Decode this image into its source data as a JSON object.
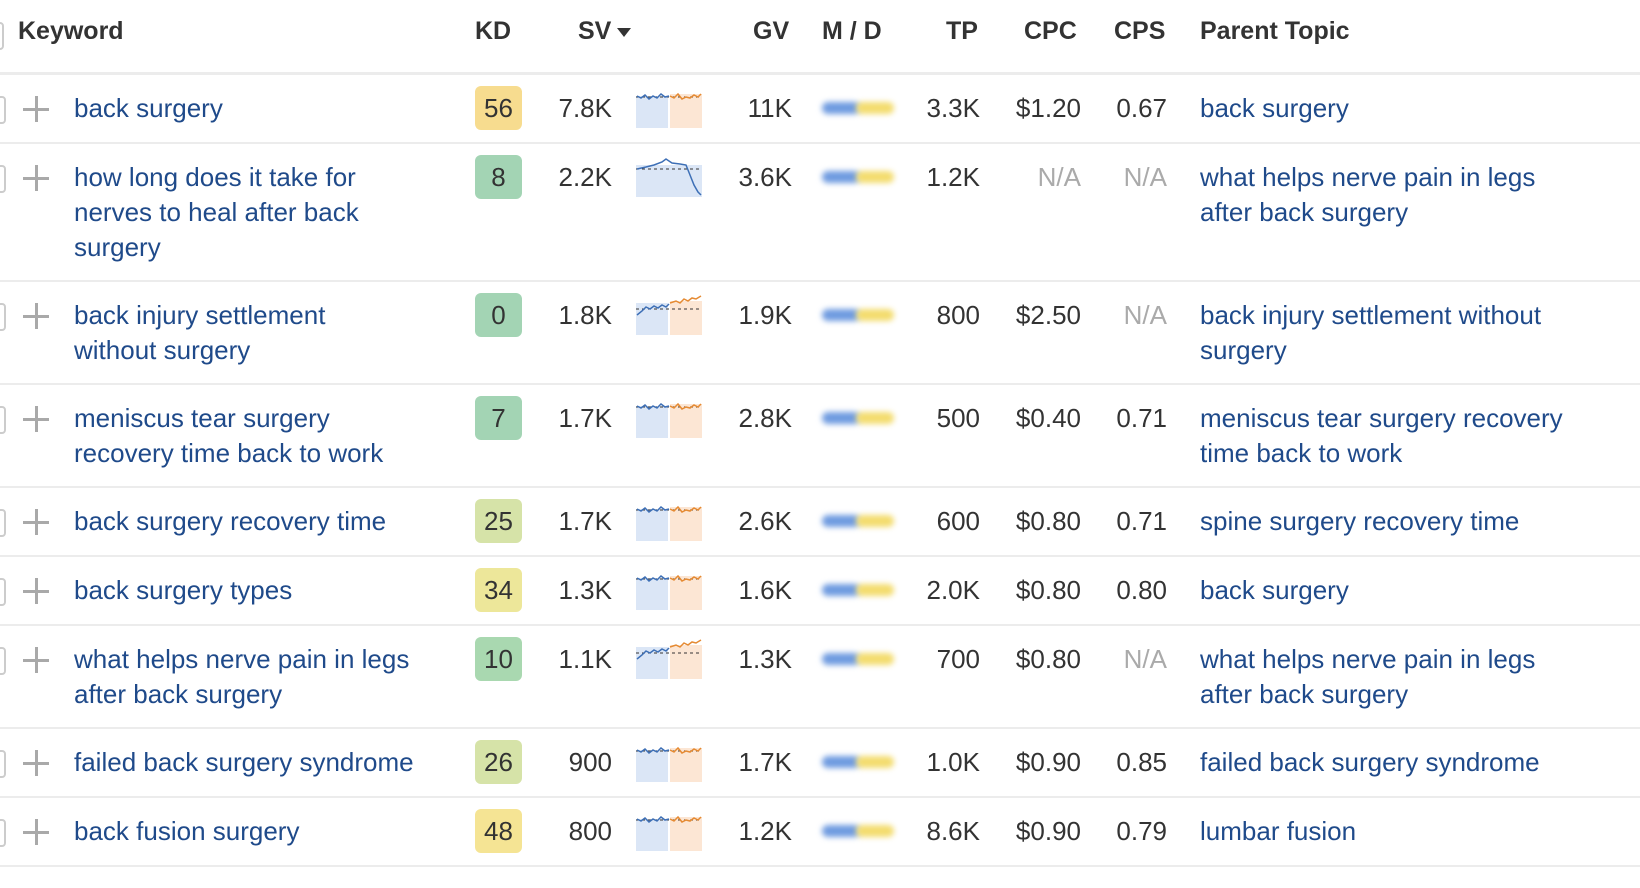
{
  "header": {
    "keyword": "Keyword",
    "kd": "KD",
    "sv": "SV",
    "sv_sort": "descending",
    "gv": "GV",
    "md": "M / D",
    "tp": "TP",
    "cpc": "CPC",
    "cps": "CPS",
    "parent_topic": "Parent Topic"
  },
  "kd_colors": {
    "easy": "#a3d4b4",
    "medium_low": "#d6e3a8",
    "medium": "#ede79a",
    "hard": "#f7dc8f"
  },
  "rows": [
    {
      "keyword": [
        "back surgery"
      ],
      "kd": "56",
      "kd_color": "#f7dc8f",
      "sv": "7.8K",
      "trend": "flat",
      "gv": "11K",
      "tp": "3.3K",
      "cpc": "$1.20",
      "cps": "0.67",
      "parent": [
        "back surgery"
      ]
    },
    {
      "keyword": [
        "how long does it take for",
        "nerves to heal after back",
        "surgery"
      ],
      "kd": "8",
      "kd_color": "#a3d4b4",
      "sv": "2.2K",
      "trend": "drop",
      "gv": "3.6K",
      "tp": "1.2K",
      "cpc": "N/A",
      "cps": "N/A",
      "parent": [
        "what helps nerve pain in legs",
        "after back surgery"
      ]
    },
    {
      "keyword": [
        "back injury settlement",
        "without surgery"
      ],
      "kd": "0",
      "kd_color": "#a3d4b4",
      "sv": "1.8K",
      "trend": "rising",
      "gv": "1.9K",
      "tp": "800",
      "cpc": "$2.50",
      "cps": "N/A",
      "parent": [
        "back injury settlement without",
        "surgery"
      ]
    },
    {
      "keyword": [
        "meniscus tear surgery",
        "recovery time back to work"
      ],
      "kd": "7",
      "kd_color": "#a3d4b4",
      "sv": "1.7K",
      "trend": "flat",
      "gv": "2.8K",
      "tp": "500",
      "cpc": "$0.40",
      "cps": "0.71",
      "parent": [
        "meniscus tear surgery recovery",
        "time back to work"
      ]
    },
    {
      "keyword": [
        "back surgery recovery time"
      ],
      "kd": "25",
      "kd_color": "#d6e3a8",
      "sv": "1.7K",
      "trend": "flat",
      "gv": "2.6K",
      "tp": "600",
      "cpc": "$0.80",
      "cps": "0.71",
      "parent": [
        "spine surgery recovery time"
      ]
    },
    {
      "keyword": [
        "back surgery types"
      ],
      "kd": "34",
      "kd_color": "#ede79a",
      "sv": "1.3K",
      "trend": "flat",
      "gv": "1.6K",
      "tp": "2.0K",
      "cpc": "$0.80",
      "cps": "0.80",
      "parent": [
        "back surgery"
      ]
    },
    {
      "keyword": [
        "what helps nerve pain in legs",
        "after back surgery"
      ],
      "kd": "10",
      "kd_color": "#a9d8b0",
      "sv": "1.1K",
      "trend": "rising",
      "gv": "1.3K",
      "tp": "700",
      "cpc": "$0.80",
      "cps": "N/A",
      "parent": [
        "what helps nerve pain in legs",
        "after back surgery"
      ]
    },
    {
      "keyword": [
        "failed back surgery syndrome"
      ],
      "kd": "26",
      "kd_color": "#d6e3a8",
      "sv": "900",
      "trend": "flat",
      "gv": "1.7K",
      "tp": "1.0K",
      "cpc": "$0.90",
      "cps": "0.85",
      "parent": [
        "failed back surgery syndrome"
      ]
    },
    {
      "keyword": [
        "back fusion surgery"
      ],
      "kd": "48",
      "kd_color": "#f5e494",
      "sv": "800",
      "trend": "flat",
      "gv": "1.2K",
      "tp": "8.6K",
      "cpc": "$0.90",
      "cps": "0.79",
      "parent": [
        "lumbar fusion"
      ]
    }
  ]
}
